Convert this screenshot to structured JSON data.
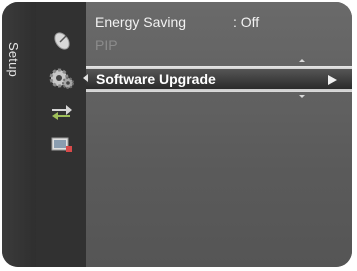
{
  "sidebar": {
    "label": "Setup"
  },
  "categories": [
    {
      "name": "satellite-dish-icon"
    },
    {
      "name": "gear-icon"
    },
    {
      "name": "arrows-icon"
    },
    {
      "name": "tv-input-icon"
    }
  ],
  "menu": {
    "items": [
      {
        "label": "Energy Saving",
        "value": ": Off",
        "state": "normal"
      },
      {
        "label": "PIP",
        "value": "",
        "state": "disabled"
      },
      {
        "label": "Software Upgrade",
        "value": "",
        "state": "selected"
      }
    ]
  },
  "colors": {
    "background": "#5d5d5d",
    "sidebar": "#313131",
    "text": "#f2f2f2",
    "disabled_text": "#8c8c8c"
  }
}
